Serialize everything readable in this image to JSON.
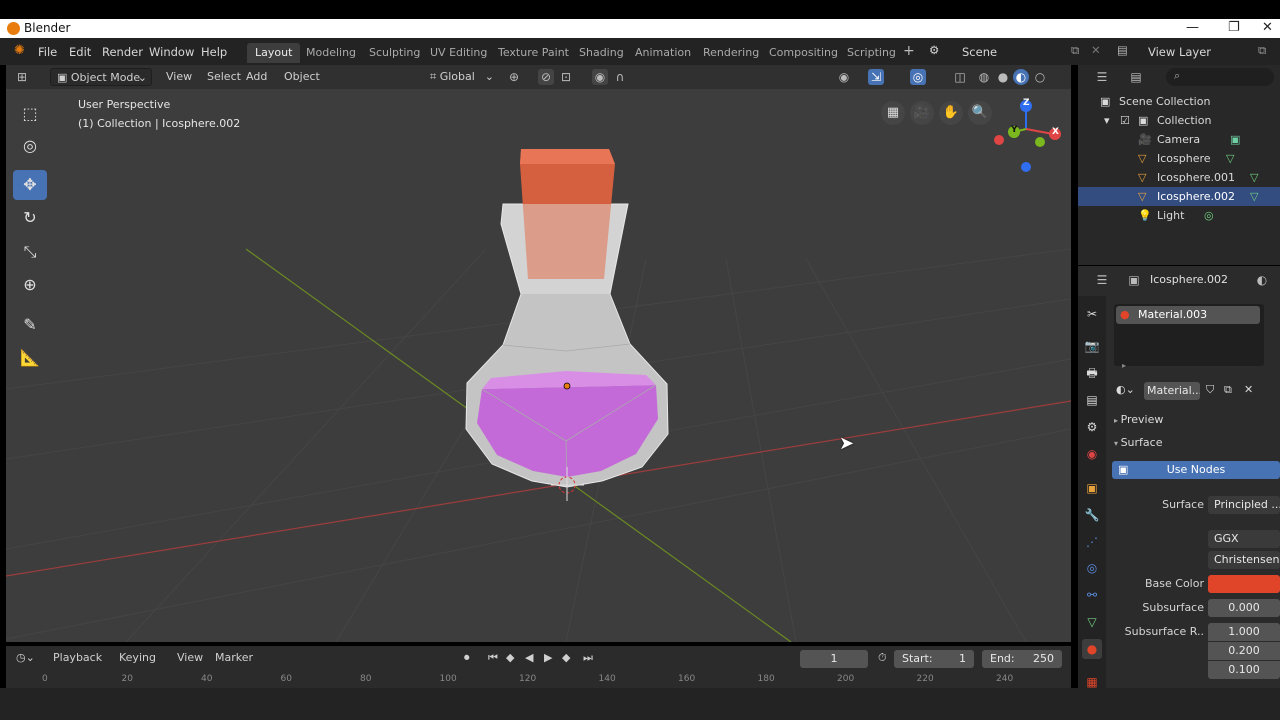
{
  "window": {
    "title": "Blender"
  },
  "menu": [
    "File",
    "Edit",
    "Render",
    "Window",
    "Help"
  ],
  "workspaces": [
    "Layout",
    "Modeling",
    "Sculpting",
    "UV Editing",
    "Texture Paint",
    "Shading",
    "Animation",
    "Rendering",
    "Compositing",
    "Scripting"
  ],
  "active_workspace": "Layout",
  "scene": {
    "name": "Scene",
    "view_layer": "View Layer"
  },
  "header": {
    "mode": "Object Mode",
    "view": "View",
    "select": "Select",
    "add": "Add",
    "object": "Object",
    "orientation": "Global"
  },
  "viewport": {
    "perspective": "User Perspective",
    "collection_info": "(1) Collection | Icosphere.002",
    "gizmo": {
      "z": "Z",
      "y": "Y",
      "x": "X"
    }
  },
  "timeline": {
    "playback": "Playback",
    "keying": "Keying",
    "view": "View",
    "marker": "Marker",
    "current_frame": "1",
    "start_label": "Start:",
    "start": "1",
    "end_label": "End:",
    "end": "250",
    "ruler": [
      "0",
      "20",
      "40",
      "60",
      "80",
      "100",
      "120",
      "140",
      "160",
      "180",
      "200",
      "220",
      "240"
    ]
  },
  "outliner": {
    "root": "Scene Collection",
    "collection": "Collection",
    "items": [
      "Camera",
      "Icosphere",
      "Icosphere.001",
      "Icosphere.002",
      "Light"
    ],
    "selected": "Icosphere.002"
  },
  "properties": {
    "object_name": "Icosphere.002",
    "material_slot": "Material.003",
    "material_name": "Material...",
    "preview": "Preview",
    "surface_panel": "Surface",
    "use_nodes": "Use Nodes",
    "surface_label": "Surface",
    "surface_value": "Principled ...",
    "distribution": "GGX",
    "subsurface_method": "Christensen-...",
    "base_color_label": "Base Color",
    "base_color": "#e0452a",
    "subsurface_label": "Subsurface",
    "subsurface_value": "0.000",
    "subsurface_radius_label": "Subsurface R..",
    "subsurface_radius": [
      "1.000",
      "0.200",
      "0.100"
    ]
  },
  "colors": {
    "accent": "#4772b3",
    "selection": "#334d80",
    "potion_liquid": "#c46ad8",
    "cork": "#d4603f"
  }
}
